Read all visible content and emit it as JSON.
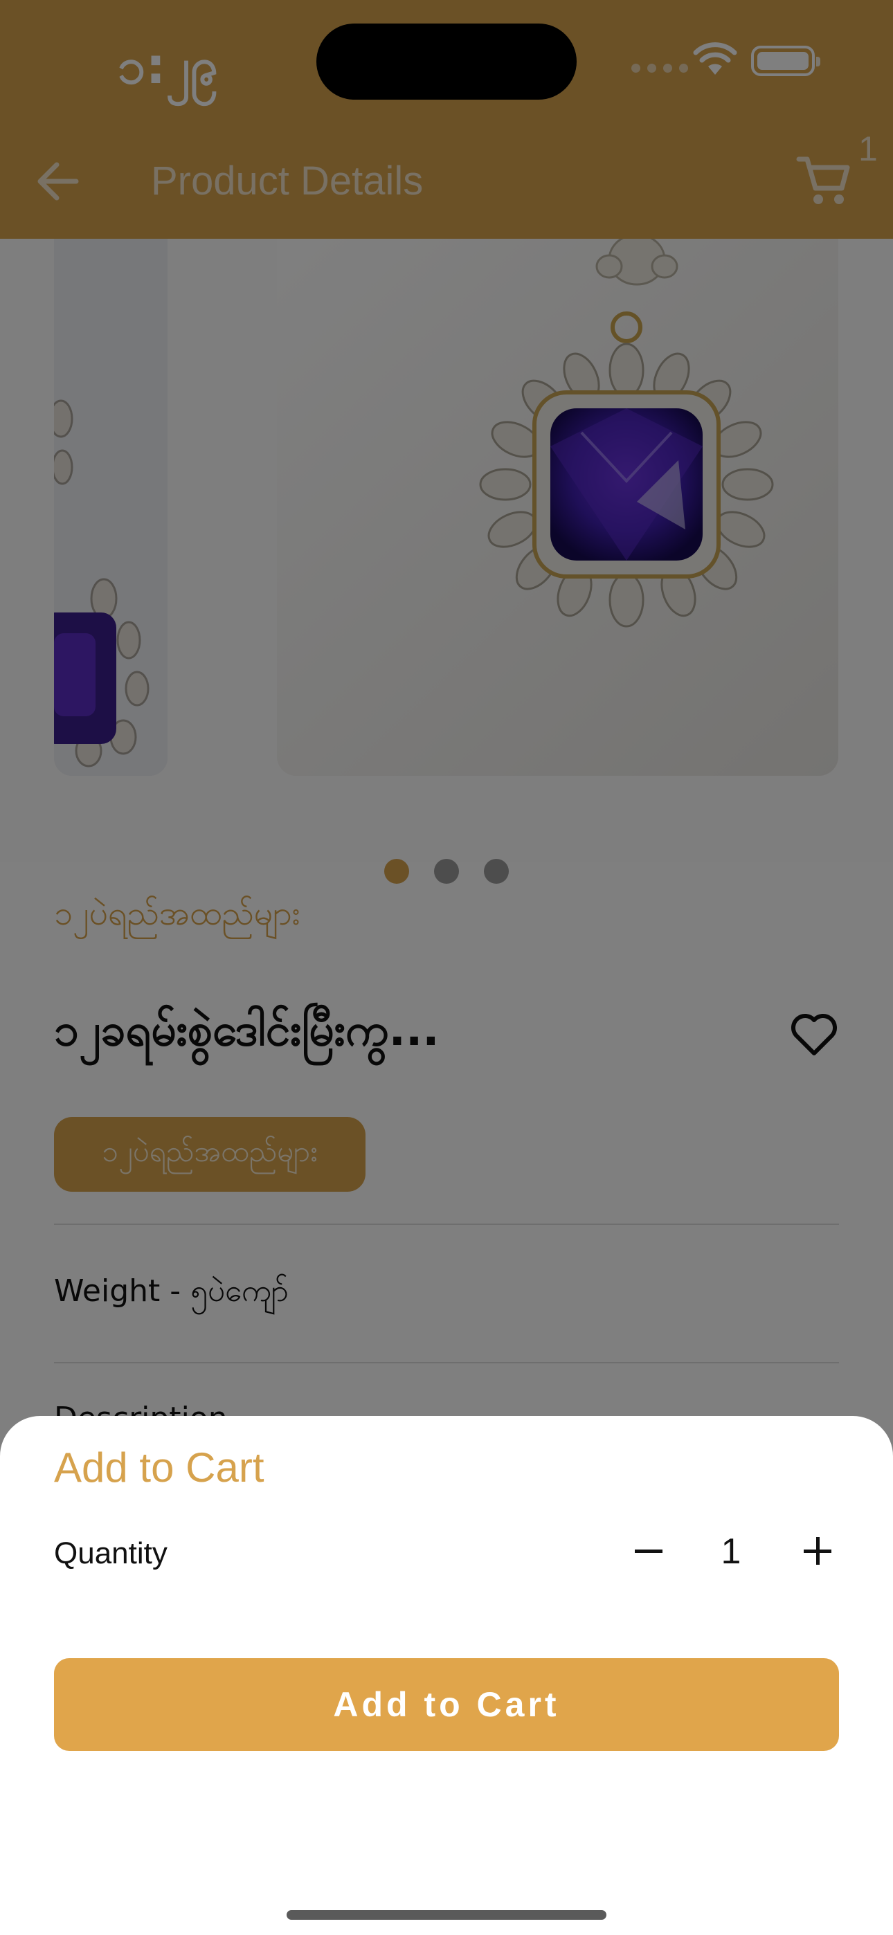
{
  "status_bar": {
    "time": "၁:၂၉"
  },
  "header": {
    "title": "Product Details",
    "cart_count": "1"
  },
  "carousel": {
    "slide_count": 3,
    "active_index": 0
  },
  "product": {
    "category": "၁၂ပဲရည်အထည်များ",
    "name": "၁၂ခရမ်းစွဲဒေါင်းမြီးကွ...",
    "tag": "၁၂ပဲရည်အထည်များ",
    "weight": "Weight - ၅ပဲကျော်",
    "description_label": "Description"
  },
  "sheet": {
    "title": "Add to Cart",
    "quantity_label": "Quantity",
    "quantity_value": "1",
    "button_label": "Add to Cart"
  },
  "colors": {
    "accent": "#d6a24d",
    "button": "#e0a54b"
  }
}
